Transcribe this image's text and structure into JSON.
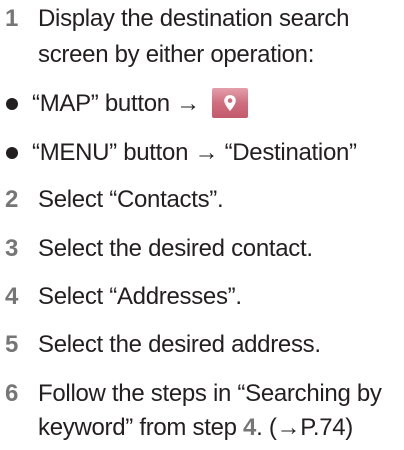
{
  "steps": [
    {
      "num": "1",
      "lines": [
        "Display the destination search",
        "screen by either operation:"
      ]
    },
    {
      "num": "2",
      "text": "Select “Contacts”."
    },
    {
      "num": "3",
      "text": "Select the desired contact."
    },
    {
      "num": "4",
      "text": "Select “Addresses”."
    },
    {
      "num": "5",
      "text": "Select the desired address."
    },
    {
      "num": "6",
      "line1": "Follow the steps in “Searching by",
      "line2_pre": "keyword” from step ",
      "line2_num": "4",
      "line2_post": ". (→P.74)"
    }
  ],
  "bullets": [
    {
      "text": "“MAP” button →",
      "icon": "map-pin-icon"
    },
    {
      "text": "“MENU” button → “Destination”"
    }
  ],
  "colors": {
    "step_number": "#767676",
    "icon_bg": "#cf6d7f",
    "text": "#231f20"
  }
}
